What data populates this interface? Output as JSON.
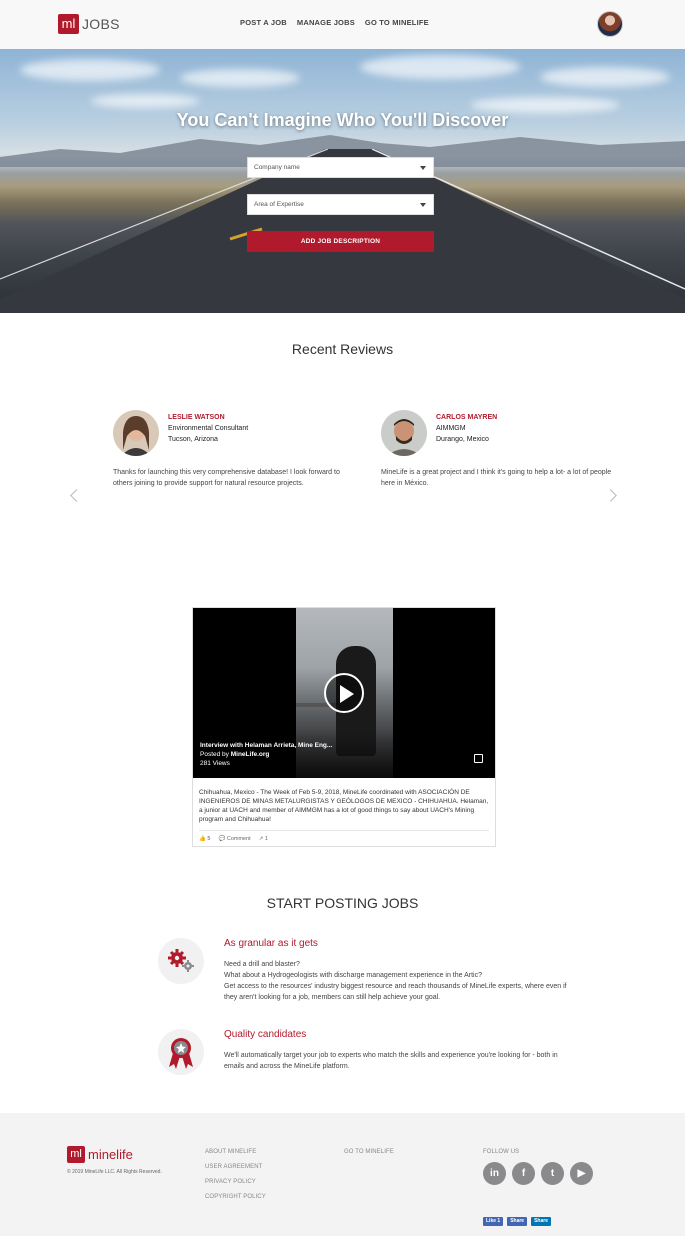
{
  "header": {
    "logo_mark": "ml",
    "logo_text": "JOBS",
    "nav": [
      "POST A JOB",
      "MANAGE JOBS",
      "GO TO MINELIFE"
    ]
  },
  "hero": {
    "title": "You Can't Imagine Who You'll Discover",
    "company_select": "Company name",
    "expertise_select": "Area of Expertise",
    "add_button": "ADD JOB DESCRIPTION"
  },
  "reviews": {
    "title": "Recent Reviews",
    "items": [
      {
        "name": "LESLIE WATSON",
        "role": "Environmental Consultant",
        "location": "Tucson, Arizona",
        "text": "Thanks for launching this very comprehensive database! I look forward to others joining to provide support for natural resource projects."
      },
      {
        "name": "CARLOS MAYREN",
        "role": "AIMMGM",
        "location": "Durango, Mexico",
        "text": "MineLife is a great project and I think it's going to help a lot- a lot of people here in México."
      }
    ]
  },
  "video": {
    "title": "Interview with Helaman Arrieta, Mine Eng...",
    "posted_prefix": "Posted by",
    "posted_by": "MineLife.org",
    "views": "281 Views",
    "description": "Chihuahua, Mexico - The Week of Feb 5-9, 2018, MineLife coordinated with ASOCIACIÓN DE INGENIEROS DE MINAS METALURGISTAS Y GEÓLOGOS DE MEXICO - CHIHUAHUA. Helaman, a junior at UACH and member of AIMMGM has a lot of good things to say about UACH's Mining program and Chihuahua!",
    "likes": "5",
    "comment": "Comment",
    "shares": "1"
  },
  "posting": {
    "title": "START POSTING JOBS",
    "features": [
      {
        "title": "As granular as it gets",
        "lines": [
          "Need a drill and blaster?",
          "What about a Hydrogeologists with discharge management experience in the Artic?",
          "Get access to the resources' industry biggest resource and reach thousands of MineLife experts, where even if they aren't looking for a job, members can still help achieve your goal."
        ],
        "icon": "gears-icon"
      },
      {
        "title": "Quality candidates",
        "lines": [
          "We'll automatically target your job to experts who match the skills and experience you're looking for - both in emails and across the MineLife platform."
        ],
        "icon": "award-ribbon-icon"
      }
    ]
  },
  "footer": {
    "logo_mark": "ml",
    "logo_text": "minelife",
    "copyright": "© 2019 MineLife LLC. All Rights Reserved.",
    "links_col1": [
      "ABOUT MINELIFE",
      "USER AGREEMENT",
      "PRIVACY POLICY",
      "COPYRIGHT POLICY"
    ],
    "links_col2": [
      "GO TO MINELIFE"
    ],
    "follow": "FOLLOW US",
    "socials": [
      "in",
      "f",
      "t",
      "▶"
    ],
    "share_buttons": [
      "Like 1",
      "Share",
      "Share"
    ]
  },
  "colors": {
    "brand_red": "#b01a2c",
    "footer_bg": "#f3f3f4",
    "social_grey": "#8a8a8d"
  }
}
